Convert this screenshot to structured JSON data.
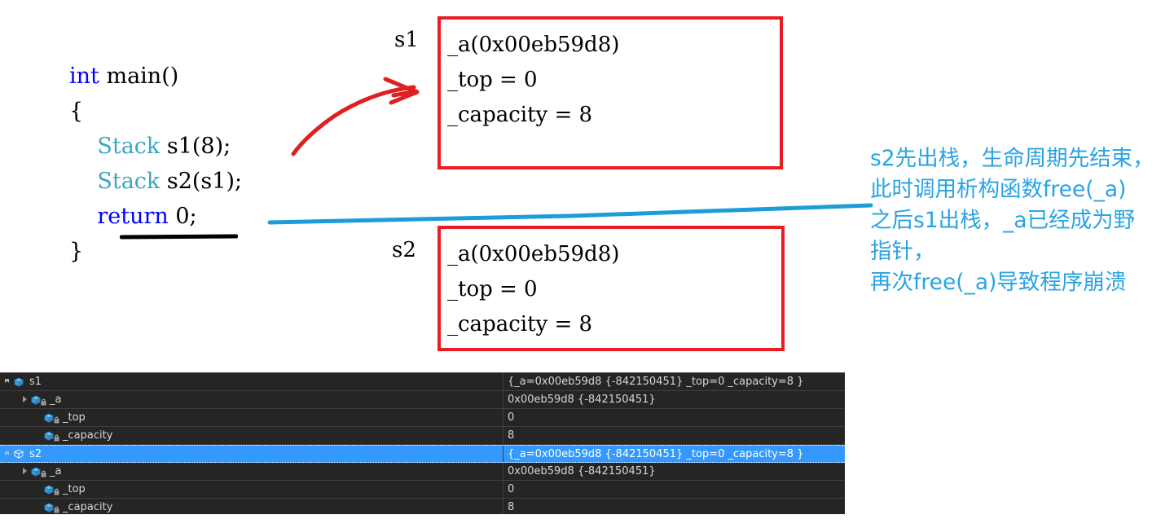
{
  "code": {
    "lines": [
      [
        {
          "t": "int ",
          "c": "kw-blue"
        },
        {
          "t": "main()",
          "c": "ident"
        }
      ],
      [
        {
          "t": "{",
          "c": "ident"
        }
      ],
      [
        {
          "t": "    ",
          "c": "ident"
        },
        {
          "t": "Stack",
          "c": "kw-teal"
        },
        {
          "t": " s1(8);",
          "c": "ident"
        }
      ],
      [
        {
          "t": "    ",
          "c": "ident"
        },
        {
          "t": "Stack",
          "c": "kw-teal"
        },
        {
          "t": " s2(s1);",
          "c": "ident"
        }
      ],
      [
        {
          "t": "    ",
          "c": "ident"
        },
        {
          "t": "return",
          "c": "kw-blue"
        },
        {
          "t": " 0;",
          "c": "ident"
        }
      ],
      [
        {
          "t": "}",
          "c": "ident"
        }
      ]
    ]
  },
  "boxes": [
    {
      "tag": "s1",
      "lines": [
        "_a(0x00eb59d8)",
        "_top = 0",
        "_capacity = 8"
      ]
    },
    {
      "tag": "s2",
      "lines": [
        "_a(0x00eb59d8)",
        "_top = 0",
        "_capacity = 8"
      ]
    }
  ],
  "note_cn": "s2先出栈，生命周期先结束，此时调用析构函数free(_a)\n之后s1出栈，_a已经成为野指针，\n再次free(_a)导致程序崩溃",
  "colors": {
    "box_border": "#ec1c24",
    "arrow_red": "#e02020",
    "line_blue": "#1e9cd7",
    "note_blue": "#29a3e3",
    "keyword_blue": "#0000ff",
    "type_teal": "#3ba7c2",
    "panel_bg": "#252526",
    "panel_selected": "#3399ff"
  },
  "watch_panel": {
    "rows": [
      {
        "indent": 0,
        "twisty": "expanded",
        "icon": "cube-icon",
        "name": "s1",
        "value": "{_a=0x00eb59d8 {-842150451} _top=0 _capacity=8 }",
        "selected": false
      },
      {
        "indent": 1,
        "twisty": "collapsed",
        "icon": "cube-lock-icon",
        "name": "_a",
        "value": "0x00eb59d8 {-842150451}",
        "selected": false
      },
      {
        "indent": 2,
        "twisty": "none",
        "icon": "cube-lock-icon",
        "name": "_top",
        "value": "0",
        "selected": false
      },
      {
        "indent": 2,
        "twisty": "none",
        "icon": "cube-lock-icon",
        "name": "_capacity",
        "value": "8",
        "selected": false
      },
      {
        "indent": 0,
        "twisty": "expanded",
        "icon": "cube-icon-selected",
        "name": "s2",
        "value": "{_a=0x00eb59d8 {-842150451} _top=0 _capacity=8 }",
        "selected": true
      },
      {
        "indent": 1,
        "twisty": "collapsed",
        "icon": "cube-lock-icon",
        "name": "_a",
        "value": "0x00eb59d8 {-842150451}",
        "selected": false
      },
      {
        "indent": 2,
        "twisty": "none",
        "icon": "cube-lock-icon",
        "name": "_top",
        "value": "0",
        "selected": false
      },
      {
        "indent": 2,
        "twisty": "none",
        "icon": "cube-lock-icon",
        "name": "_capacity",
        "value": "8",
        "selected": false
      }
    ]
  }
}
